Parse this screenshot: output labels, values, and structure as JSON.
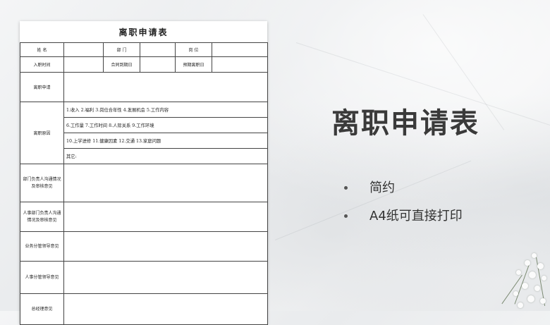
{
  "form": {
    "title": "离职申请表",
    "name_label": "姓 名",
    "dept_label": "部 门",
    "position_label": "岗 位",
    "join_date_label": "入职时间",
    "contract_end_label": "合同到期日",
    "expected_leave_label": "预期离职日",
    "apply_label": "离职申请",
    "reason_label": "离职原因",
    "reason_row1": "1.收入 2.福利 3.岗位合年性 4.发展机会 5.工作内容",
    "reason_row2": "6.工作量 7.工作时间 8.人际关系 9.工作环境",
    "reason_row3": "10.上学进修 11.健康因素 12.交通 13.家庭问题",
    "reason_other": "其它:",
    "dept_head_label": "部门负责人沟通情况及审核意见",
    "hr_dept_head_label": "人事部门负责人沟通情况及审核意见",
    "biz_leader_label": "业务分管领导意见",
    "hr_leader_label": "人事分管领导意见",
    "gm_label": "总经理意见"
  },
  "promo": {
    "heading": "离职申请表",
    "bullets": [
      "简约",
      "A4纸可直接打印"
    ]
  }
}
